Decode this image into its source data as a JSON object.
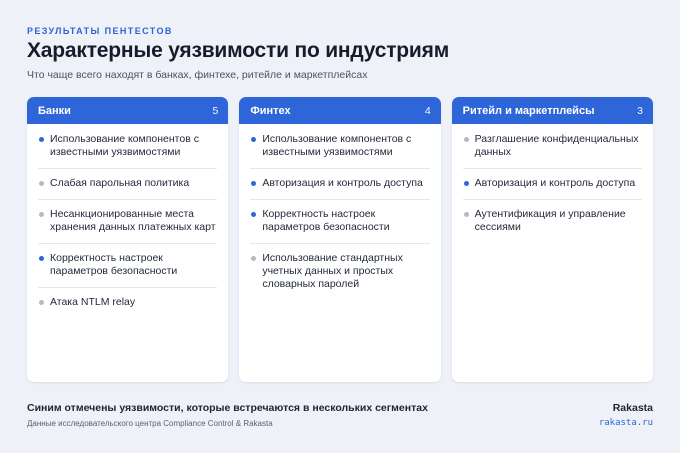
{
  "header": {
    "eyebrow": "РЕЗУЛЬТАТЫ ПЕНТЕСТОВ",
    "title": "Характерные уязвимости по индустриям",
    "subtitle": "Что чаще всего находят в банках, финтехе, ритейле и маркетплейсах"
  },
  "colors": {
    "accent": "#2e66d9",
    "dot_shared": "#2e66d9",
    "dot_unique": "#b3b9c6"
  },
  "cards": [
    {
      "name": "Банки",
      "count": "5",
      "items": [
        {
          "text": "Использование компонентов с известными уязвимостями",
          "shared": true
        },
        {
          "text": "Слабая парольная политика",
          "shared": false
        },
        {
          "text": "Несанкционированные места хранения данных платежных карт",
          "shared": false
        },
        {
          "text": "Корректность настроек параметров безопасности",
          "shared": true
        },
        {
          "text": "Атака NTLM relay",
          "shared": false
        }
      ]
    },
    {
      "name": "Финтех",
      "count": "4",
      "items": [
        {
          "text": "Использование компонентов с известными уязвимостями",
          "shared": true
        },
        {
          "text": "Авторизация и контроль доступа",
          "shared": true
        },
        {
          "text": "Корректность настроек параметров безопасности",
          "shared": true
        },
        {
          "text": "Использование стандартных учетных данных и простых словарных паролей",
          "shared": false
        }
      ]
    },
    {
      "name": "Ритейл и маркетплейсы",
      "count": "3",
      "items": [
        {
          "text": "Разглашение конфиденциальных данных",
          "shared": false
        },
        {
          "text": "Авторизация и контроль доступа",
          "shared": true
        },
        {
          "text": "Аутентификация и управление сессиями",
          "shared": false
        }
      ]
    }
  ],
  "footer": {
    "note": "Синим отмечены уязвимости, которые встречаются в нескольких сегментах",
    "source": "Данные исследовательского центра Compliance Control & Rakasta",
    "brand": "Rakasta",
    "url": "rakasta.ru"
  }
}
